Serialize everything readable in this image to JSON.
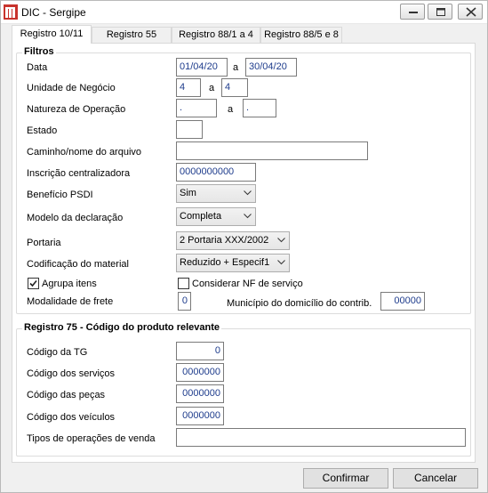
{
  "window": {
    "title": "DIC - Sergipe",
    "icon": "app-logo-icon"
  },
  "tabs": [
    {
      "label": "Registro 10/11",
      "active": true
    },
    {
      "label": "Registro 55",
      "active": false
    },
    {
      "label": "Registro 88/1 a 4",
      "active": false
    },
    {
      "label": "Registro 88/5 e 8",
      "active": false
    }
  ],
  "filtros": {
    "title": "Filtros",
    "data_label": "Data",
    "data_from": "01/04/20",
    "data_sep": "a",
    "data_to": "30/04/20",
    "unidade_label": "Unidade de Negócio",
    "unidade_from": "4",
    "unidade_sep": "a",
    "unidade_to": "4",
    "natureza_label": "Natureza de Operação",
    "natureza_from": ".",
    "natureza_sep": "a",
    "natureza_to": ".",
    "estado_label": "Estado",
    "estado_value": "",
    "caminho_label": "Caminho/nome do arquivo",
    "caminho_value": "",
    "inscricao_label": "Inscrição centralizadora",
    "inscricao_value": "0000000000",
    "beneficio_label": "Benefício PSDI",
    "beneficio_value": "Sim",
    "modelo_label": "Modelo da declaração",
    "modelo_value": "Completa",
    "portaria_label": "Portaria",
    "portaria_value": "2 Portaria XXX/2002",
    "codificacao_label": "Codificação do material",
    "codificacao_value": "Reduzido + Especif1",
    "agrupa_label": "Agrupa itens",
    "agrupa_checked": true,
    "considerar_label": "Considerar NF de serviço",
    "considerar_checked": false,
    "modalidade_label": "Modalidade de frete",
    "modalidade_value": "0",
    "municipio_label": "Município do domicílio do contrib.",
    "municipio_value": "00000"
  },
  "registro75": {
    "title": "Registro 75 - Código do produto relevante",
    "tg_label": "Código da TG",
    "tg_value": "0",
    "servicos_label": "Código dos serviços",
    "servicos_value": "0000000",
    "pecas_label": "Código das peças",
    "pecas_value": "0000000",
    "veiculos_label": "Código dos veículos",
    "veiculos_value": "0000000",
    "tipos_label": "Tipos de operações de venda",
    "tipos_value": ""
  },
  "buttons": {
    "confirmar": "Confirmar",
    "cancelar": "Cancelar"
  }
}
